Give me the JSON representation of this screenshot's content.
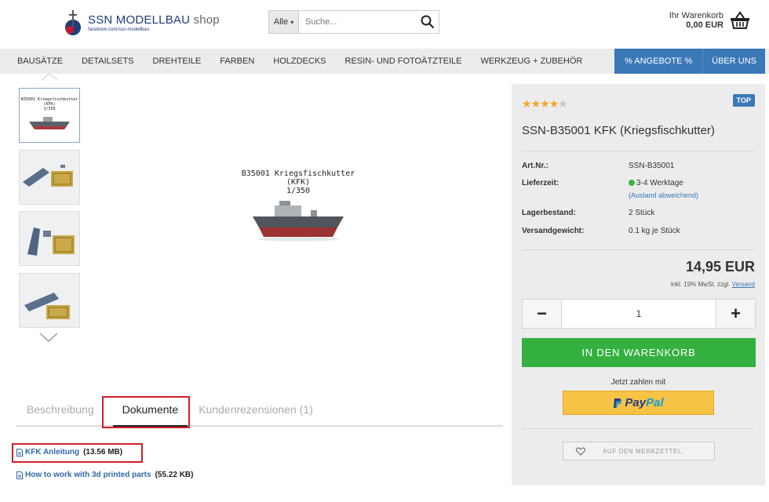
{
  "header": {
    "logo_text": "SSN MODELLBAU",
    "logo_shop": "shop",
    "logo_sub": "facebook.com/ssn-modellbau",
    "search_category": "Alle",
    "search_placeholder": "Suche...",
    "cart_label": "Ihr Warenkorb",
    "cart_total": "0,00 EUR"
  },
  "nav": {
    "items": [
      "BAUSÄTZE",
      "DETAILSETS",
      "DREHTEILE",
      "FARBEN",
      "HOLZDECKS",
      "RESIN- UND FOTOÄTZTEILE",
      "WERKZEUG + ZUBEHÖR"
    ],
    "offers": "% ANGEBOTE %",
    "about": "ÜBER UNS"
  },
  "gallery": {
    "main_title_line1": "B35001 Kriegsfischkutter",
    "main_title_line2": "(KFK)",
    "main_title_line3": "1/350",
    "thumb_title_line1": "B35001 Kriegsfischkutter",
    "thumb_title_line2": "(KFK)",
    "thumb_title_line3": "1/350"
  },
  "tabs": {
    "description": "Beschreibung",
    "documents": "Dokumente",
    "reviews": "Kundenrezensionen (1)"
  },
  "documents": [
    {
      "name": "KFK Anleitung",
      "size": "(13.56 MB)"
    },
    {
      "name": "How to work with 3d printed parts",
      "size": "(55.22 KB)"
    }
  ],
  "product": {
    "rating": 4,
    "rating_max": 5,
    "badge": "TOP",
    "title": "SSN-B35001 KFK (Kriegsfischkutter)",
    "art_nr_label": "Art.Nr.:",
    "art_nr": "SSN-B35001",
    "delivery_label": "Lieferzeit:",
    "delivery": "3-4 Werktage",
    "delivery_note": "(Ausland abweichend)",
    "stock_label": "Lagerbestand:",
    "stock": "2 Stück",
    "weight_label": "Versandgewicht:",
    "weight": "0.1 kg je Stück",
    "price": "14,95 EUR",
    "vat_text": "inkl. 19% MwSt. zzgl.",
    "shipping_link": "Versand",
    "quantity": "1",
    "minus": "−",
    "plus": "+",
    "add_to_cart": "IN DEN WARENKORB",
    "pay_with": "Jetzt zahlen mit",
    "paypal_1": "Pay",
    "paypal_2": "Pal",
    "wishlist": "AUF DEN MERKZETTEL"
  }
}
